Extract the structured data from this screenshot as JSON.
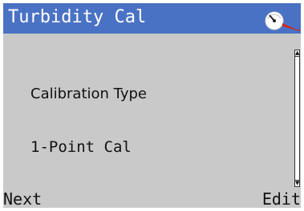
{
  "header": {
    "title": "Turbidity Cal",
    "icon": "gauge-icon",
    "icon_colors": {
      "dial": "#ffffff",
      "needle": "#222222",
      "pointer": "#cc2a1e"
    }
  },
  "content": {
    "field_label": "Calibration Type",
    "field_value": "1-Point Cal"
  },
  "scrollbar": {
    "up_arrow": "▲",
    "down_arrow": "▼"
  },
  "softkeys": {
    "left": "Next",
    "right": "Edit"
  },
  "colors": {
    "titlebar": "#4a72c4",
    "background": "#c9c9c9",
    "text": "#111111"
  }
}
